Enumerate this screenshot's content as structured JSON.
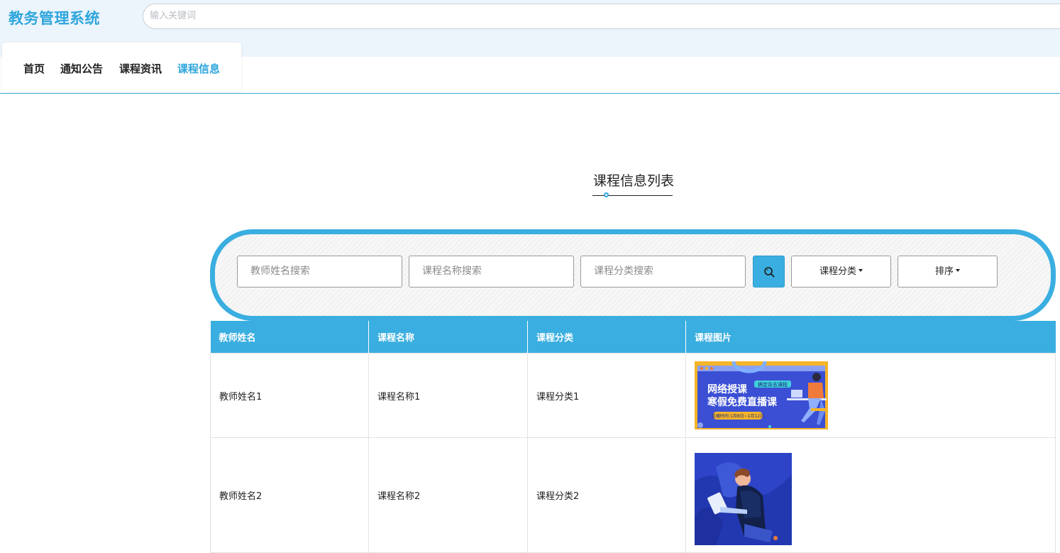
{
  "header": {
    "logo": "教务管理系统",
    "search_placeholder": "输入关键词"
  },
  "nav": {
    "items": [
      {
        "label": "首页",
        "active": false
      },
      {
        "label": "通知公告",
        "active": false
      },
      {
        "label": "课程资讯",
        "active": false
      },
      {
        "label": "课程信息",
        "active": true
      }
    ]
  },
  "section": {
    "title": "课程信息列表"
  },
  "filters": {
    "teacher_placeholder": "教师姓名搜索",
    "course_placeholder": "课程名称搜索",
    "category_placeholder": "课程分类搜索",
    "category_dropdown": "课程分类",
    "sort_dropdown": "排序"
  },
  "table": {
    "headers": [
      "教师姓名",
      "课程名称",
      "课程分类",
      "课程图片"
    ],
    "rows": [
      {
        "teacher": "教师姓名1",
        "course": "课程名称1",
        "category": "课程分类1",
        "image": {
          "line1": "网络授课",
          "line2": "寒假免费直播课",
          "tag": "搞定杂志课程",
          "sub": "直播时间:1月8日~1月12日"
        }
      },
      {
        "teacher": "教师姓名2",
        "course": "课程名称2",
        "category": "课程分类2"
      }
    ]
  },
  "colors": {
    "accent": "#3aaee0",
    "logo": "#2fa6dc",
    "topbar_bg": "#ecf4fc"
  }
}
